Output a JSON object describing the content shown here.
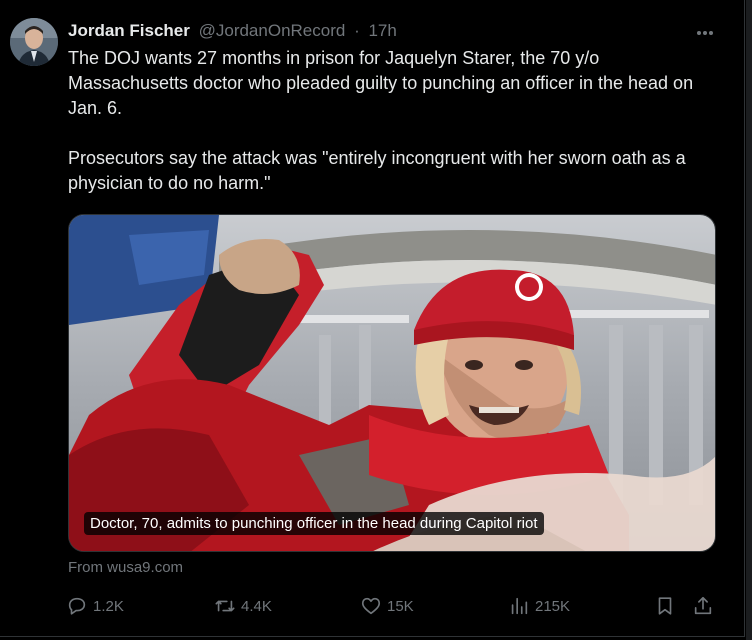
{
  "post": {
    "author_name": "Jordan Fischer",
    "author_handle": "@JordanOnRecord",
    "separator": "·",
    "time_ago": "17h",
    "more_icon": "more-dots-icon",
    "text_paragraph_1": "The DOJ wants 27 months in prison for Jaquelyn Starer, the 70 y/o Massachusetts doctor who pleaded guilty to punching an officer in the head on Jan. 6.",
    "text_paragraph_2": "Prosecutors say the attack was \"entirely incongruent with her sworn oath as a physician to do no harm.\""
  },
  "media": {
    "caption": "Doctor, 70, admits to punching officer in the head during Capitol riot",
    "source": "From wusa9.com"
  },
  "actions": {
    "replies": "1.2K",
    "reposts": "4.4K",
    "likes": "15K",
    "views": "215K"
  },
  "colors": {
    "background": "#000000",
    "text_primary": "#e7e9ea",
    "text_secondary": "#71767b",
    "border": "#2f3336"
  }
}
